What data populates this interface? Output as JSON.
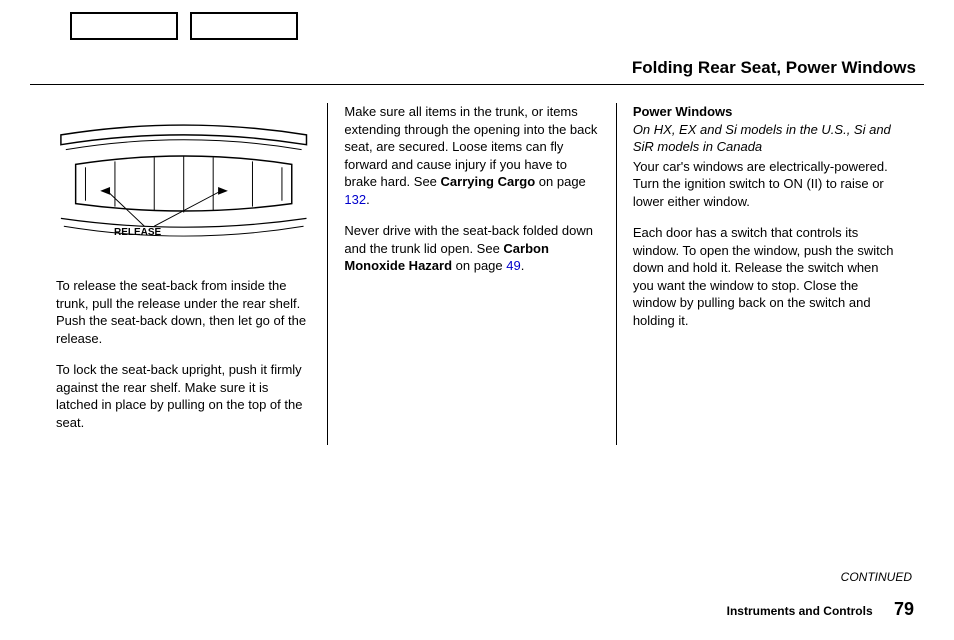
{
  "header": {
    "title": "Folding Rear Seat, Power Windows"
  },
  "figure": {
    "label": "RELEASE"
  },
  "col1": {
    "p1": "To release the seat-back from inside the trunk, pull the release under the rear shelf. Push the seat-back down, then let go of the release.",
    "p2": "To lock the seat-back upright, push it firmly against the rear shelf. Make sure it is latched in place by pulling on the top of the seat."
  },
  "col2": {
    "p1a": "Make sure all items in the trunk, or items extending through the opening into the back seat, are secured. Loose items can fly forward and cause injury if you have to brake hard. See ",
    "p1b_bold": "Carrying Cargo",
    "p1c": " on page ",
    "p1_link": "132",
    "p1d": ".",
    "p2a": "Never drive with the seat-back folded down and the trunk lid open. See ",
    "p2b_bold": "Carbon Monoxide Hazard",
    "p2c": " on page ",
    "p2_link": "49",
    "p2d": "."
  },
  "col3": {
    "heading": "Power Windows",
    "subheading": "On HX, EX and Si models in the U.S., Si and SiR models in Canada",
    "p1": "Your car's windows are electrically-powered. Turn the ignition switch to ON (II) to raise or lower either window.",
    "p2": "Each door has a switch that controls its window. To open the window, push the switch down and hold it. Release the switch when you want the window to stop. Close the window by pulling back on the switch and holding it."
  },
  "footer": {
    "continued": "CONTINUED",
    "section": "Instruments and Controls",
    "page": "79"
  }
}
